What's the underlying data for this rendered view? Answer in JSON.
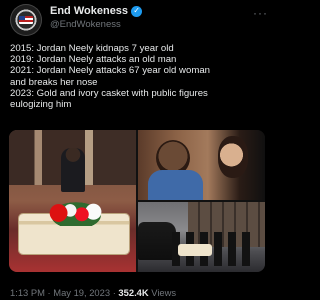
{
  "tweet": {
    "author": {
      "display_name": "End Wokeness",
      "handle": "@EndWokeness",
      "verified_icon": "verified-badge-icon",
      "verified_color": "#1d9bf0"
    },
    "more_icon": "more-options-icon",
    "text_lines": [
      "2015: Jordan Neely kidnaps 7 year old",
      "2019: Jordan Neely attacks an old man",
      "2021: Jordan Neely attacks 67 year old woman",
      "and breaks her nose",
      "2023: Gold and ivory casket with public figures",
      "eulogizing him"
    ],
    "meta": {
      "time": "1:13 PM",
      "sep1": "·",
      "date": "May 19, 2023",
      "sep2": "·",
      "views_count": "352.4K",
      "views_label": "Views"
    }
  },
  "colors": {
    "background": "#000000",
    "text_primary": "#e7e9ea",
    "text_secondary": "#71767b"
  }
}
